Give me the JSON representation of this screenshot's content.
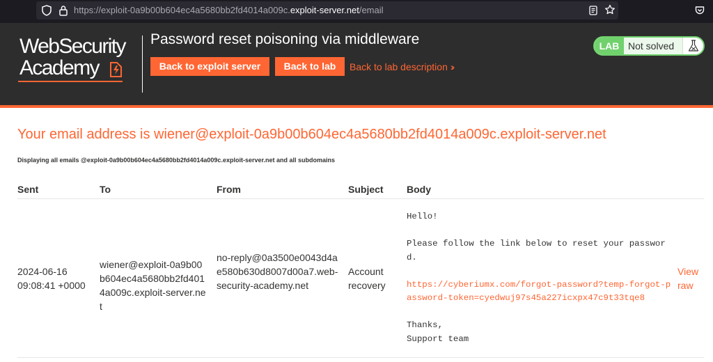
{
  "browser": {
    "url_prefix": "https://exploit-0a9b00b604ec4a5680bb2fd4014a009c.",
    "url_host": "exploit-server.net",
    "url_suffix": "/email",
    "url_host_display": "https://exploit-0a9b00b604ec4a5680bb2fd4014a009c.exploit-server.net/email"
  },
  "header": {
    "logo_line1": "WebSecurity",
    "logo_line2": "Academy",
    "lab_title": "Password reset poisoning via middleware",
    "back_to_exploit_label": "Back to exploit server",
    "back_to_lab_label": "Back to lab",
    "back_to_description_label": "Back to lab description",
    "lab_tag": "LAB",
    "lab_status": "Not solved"
  },
  "colors": {
    "accent": "#ff6633",
    "header_bg": "#2d2d2d",
    "lab_green": "#70d16d"
  },
  "content": {
    "heading": "Your email address is wiener@exploit-0a9b00b604ec4a5680bb2fd4014a009c.exploit-server.net",
    "displaying_note": "Displaying all emails @exploit-0a9b00b604ec4a5680bb2fd4014a009c.exploit-server.net and all subdomains"
  },
  "table": {
    "headers": [
      "Sent",
      "To",
      "From",
      "Subject",
      "Body"
    ],
    "rows": [
      {
        "sent": "2024-06-16 09:08:41 +0000",
        "to": "wiener@exploit-0a9b00b604ec4a5680bb2fd4014a009c.exploit-server.net",
        "from": "no-reply@0a3500e0043d4ae580b630d8007d00a7.web-security-academy.net",
        "subject": "Account recovery",
        "body_greeting": "Hello!",
        "body_instruction": "Please follow the link below to reset your password.",
        "body_link": "https://cyberiumx.com/forgot-password?temp-forgot-password-token=cyedwuj97s45a227icxpx47c9t33tqe8",
        "body_signoff": "Thanks,\nSupport team",
        "view_raw_label": "View raw"
      }
    ]
  }
}
